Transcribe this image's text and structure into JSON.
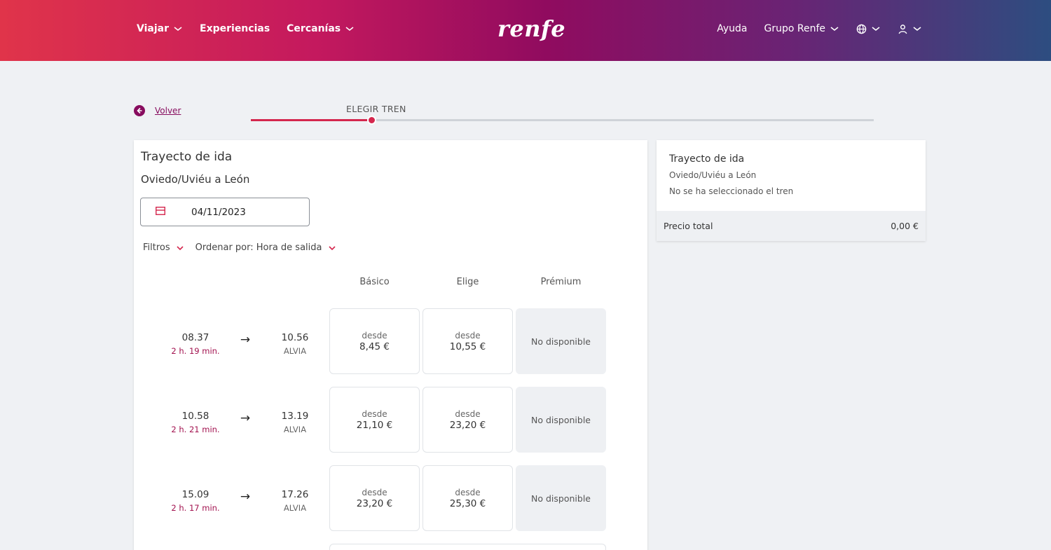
{
  "header": {
    "logo": "renfe",
    "nav_left": [
      {
        "label": "Viajar",
        "dropdown": true
      },
      {
        "label": "Experiencias",
        "dropdown": false
      },
      {
        "label": "Cercanías",
        "dropdown": true
      }
    ],
    "nav_right": {
      "help": "Ayuda",
      "group": "Grupo Renfe",
      "language_icon": "globe-icon",
      "user_icon": "user-icon"
    },
    "gradient_colors": [
      "#e0344a",
      "#c4195e",
      "#900b5f",
      "#6a2374",
      "#2d4d80"
    ]
  },
  "progress": {
    "back_label": "Volver",
    "step_label": "ELEGIR TREN",
    "accent": "#d4264d"
  },
  "trip": {
    "title": "Trayecto de ida",
    "route": "Oviedo/Uviéu a León",
    "date": "04/11/2023"
  },
  "filters": {
    "filter_label": "Filtros",
    "sort_label": "Ordenar por: Hora de salida"
  },
  "fare_columns": [
    "Básico",
    "Elige",
    "Prémium"
  ],
  "trains": [
    {
      "departure": "08.37",
      "duration": "2 h. 19 min.",
      "arrival": "10.56",
      "type": "ALVIA",
      "fares": [
        {
          "label": "desde",
          "price": "8,45 €"
        },
        {
          "label": "desde",
          "price": "10,55 €"
        },
        {
          "label": "No disponible",
          "price": ""
        }
      ]
    },
    {
      "departure": "10.58",
      "duration": "2 h. 21 min.",
      "arrival": "13.19",
      "type": "ALVIA",
      "fares": [
        {
          "label": "desde",
          "price": "21,10 €"
        },
        {
          "label": "desde",
          "price": "23,20 €"
        },
        {
          "label": "No disponible",
          "price": ""
        }
      ]
    },
    {
      "departure": "15.09",
      "duration": "2 h. 17 min.",
      "arrival": "17.26",
      "type": "ALVIA",
      "fares": [
        {
          "label": "desde",
          "price": "23,20 €"
        },
        {
          "label": "desde",
          "price": "25,30 €"
        },
        {
          "label": "No disponible",
          "price": ""
        }
      ]
    }
  ],
  "summary": {
    "title": "Trayecto de ida",
    "route": "Oviedo/Uviéu a León",
    "status": "No se ha seleccionado el tren",
    "total_label": "Precio total",
    "total_value": "0,00 €"
  }
}
